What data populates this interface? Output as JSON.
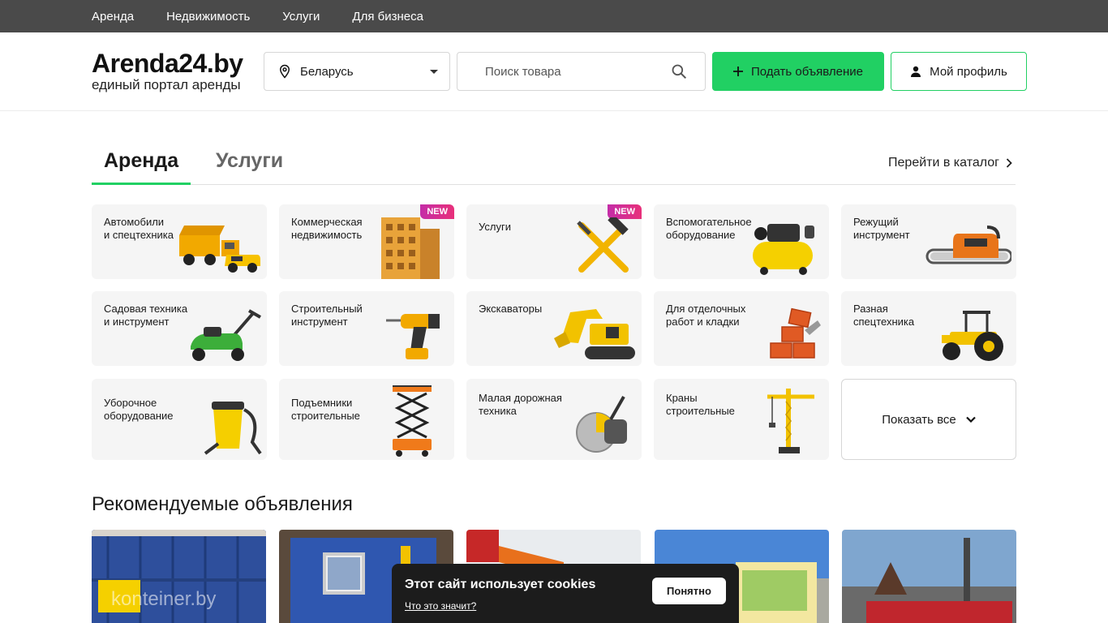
{
  "topnav": {
    "items": [
      "Аренда",
      "Недвижимость",
      "Услуги",
      "Для бизнеса"
    ]
  },
  "header": {
    "logo_title": "Arenda24.by",
    "logo_subtitle": "единый портал аренды",
    "region": "Беларусь",
    "search_placeholder": "Поиск товара",
    "post_button": "Подать объявление",
    "profile_button": "Мой профиль"
  },
  "tabs": {
    "active": "Аренда",
    "services": "Услуги",
    "catalog_link": "Перейти в каталог"
  },
  "categories": [
    {
      "label": "Автомобили\nи спецтехника",
      "icon": "truck-icon",
      "badge": ""
    },
    {
      "label": "Коммерческая\nнедвижимость",
      "icon": "building-icon",
      "badge": "NEW"
    },
    {
      "label": "Услуги",
      "icon": "tools-icon",
      "badge": "NEW"
    },
    {
      "label": "Вспомогательное\nоборудование",
      "icon": "compressor-icon",
      "badge": ""
    },
    {
      "label": "Режущий\nинструмент",
      "icon": "chainsaw-icon",
      "badge": ""
    },
    {
      "label": "Садовая техника\nи инструмент",
      "icon": "lawnmower-icon",
      "badge": ""
    },
    {
      "label": "Строительный\nинструмент",
      "icon": "drill-icon",
      "badge": ""
    },
    {
      "label": "Экскаваторы",
      "icon": "excavator-icon",
      "badge": ""
    },
    {
      "label": "Для отделочных\nработ и кладки",
      "icon": "bricks-icon",
      "badge": ""
    },
    {
      "label": "Разная\nспецтехника",
      "icon": "tractor-icon",
      "badge": ""
    },
    {
      "label": "Уборочное\nоборудование",
      "icon": "vacuum-icon",
      "badge": ""
    },
    {
      "label": "Подъемники\nстроительные",
      "icon": "scissor-lift-icon",
      "badge": ""
    },
    {
      "label": "Малая дорожная\nтехника",
      "icon": "road-saw-icon",
      "badge": ""
    },
    {
      "label": "Краны\nстроительные",
      "icon": "crane-icon",
      "badge": ""
    }
  ],
  "show_all": "Показать все",
  "recommended": {
    "title": "Рекомендуемые объявления",
    "watermark": "konteiner.by"
  },
  "cookie": {
    "title": "Этот сайт использует cookies",
    "link": "Что это значит?",
    "button": "Понятно"
  },
  "colors": {
    "accent": "#21d063",
    "topnav": "#4a4a4a",
    "card": "#f5f5f5",
    "cookie_bg": "#1c1c1c"
  }
}
